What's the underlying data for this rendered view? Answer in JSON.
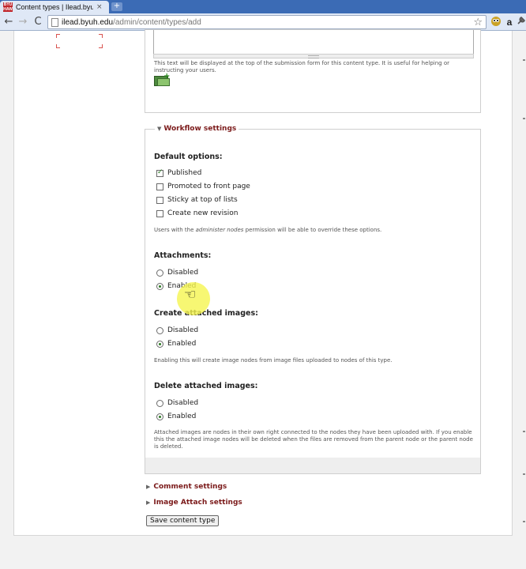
{
  "browser": {
    "tab_title": "Content types | Ilead.byuh...",
    "favicon_text": "BYU HAW",
    "tab_close": "×",
    "new_tab": "+",
    "url_host": "ilead.byuh.edu",
    "url_path": "/admin/content/types/add",
    "back": "←",
    "forward": "→",
    "reload": "C",
    "bookmark_star": "☆",
    "extensions": [
      "a"
    ]
  },
  "top_section": {
    "help_text": "This text will be displayed at the top of the submission form for this content type. It is useful for helping or instructing your users."
  },
  "workflow": {
    "legend": "Workflow settings",
    "default_options": {
      "title": "Default options:",
      "options": [
        {
          "label": "Published",
          "checked": true
        },
        {
          "label": "Promoted to front page",
          "checked": false
        },
        {
          "label": "Sticky at top of lists",
          "checked": false
        },
        {
          "label": "Create new revision",
          "checked": false
        }
      ],
      "help_before": "Users with the ",
      "help_em": "administer nodes",
      "help_after": " permission will be able to override these options."
    },
    "attachments": {
      "title": "Attachments:",
      "options": [
        {
          "label": "Disabled",
          "checked": false
        },
        {
          "label": "Enabled",
          "checked": true
        }
      ]
    },
    "create_attached_images": {
      "title": "Create attached images:",
      "options": [
        {
          "label": "Disabled",
          "checked": false
        },
        {
          "label": "Enabled",
          "checked": true
        }
      ],
      "help": "Enabling this will create image nodes from image files uploaded to nodes of this type."
    },
    "delete_attached_images": {
      "title": "Delete attached images:",
      "options": [
        {
          "label": "Disabled",
          "checked": false
        },
        {
          "label": "Enabled",
          "checked": true
        }
      ],
      "help": "Attached images are nodes in their own right connected to the nodes they have been uploaded with. If you enable this the attached image nodes will be deleted when the files are removed from the parent node or the parent node is deleted."
    }
  },
  "collapsed_sections": [
    "Comment settings",
    "Image Attach settings"
  ],
  "save_button": "Save content type",
  "colors": {
    "legend": "#7b1a1a",
    "check": "#2a7a22",
    "chrome": "#dfe8f6",
    "tabstrip": "#3b6bb5",
    "cursor_highlight": "#f5f550"
  }
}
